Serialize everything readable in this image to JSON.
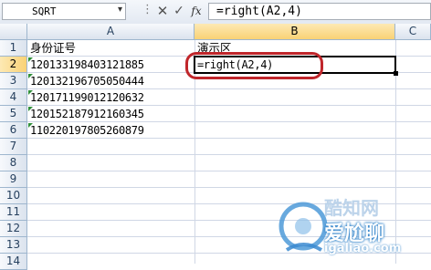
{
  "formula_bar": {
    "name_box": "SQRT",
    "dots": "⋮",
    "cancel_glyph": "✕",
    "enter_glyph": "✓",
    "fx_label": "fx",
    "formula": "=right(A2,4)"
  },
  "columns": [
    {
      "label": "A",
      "active": false
    },
    {
      "label": "B",
      "active": true
    },
    {
      "label": "C",
      "active": false
    }
  ],
  "rows": [
    "1",
    "2",
    "3",
    "4",
    "5",
    "6",
    "7",
    "8",
    "9",
    "10",
    "11",
    "12",
    "13",
    "14"
  ],
  "active_row": "2",
  "cells": {
    "A1": "身份证号",
    "B1": "演示区",
    "A2": "120133198403121885",
    "B2": "=right(A2,4)",
    "A3": "120132196705050444",
    "A4": "120171199012120632",
    "A5": "120152187912160345",
    "A6": "110220197805260879"
  },
  "watermark": {
    "line1": "酷知网",
    "line2": "爱尬聊",
    "line3": "igaliao.com"
  },
  "colors": {
    "header_border": "#9eb6ce",
    "active_header": "#f9d275",
    "annotation_red": "#c0262b",
    "error_triangle": "#2f8f3a"
  },
  "icons": {
    "cancel": "close-icon",
    "enter": "checkmark-icon",
    "function": "fx-icon",
    "name_dropdown": "chevron-down-icon"
  }
}
